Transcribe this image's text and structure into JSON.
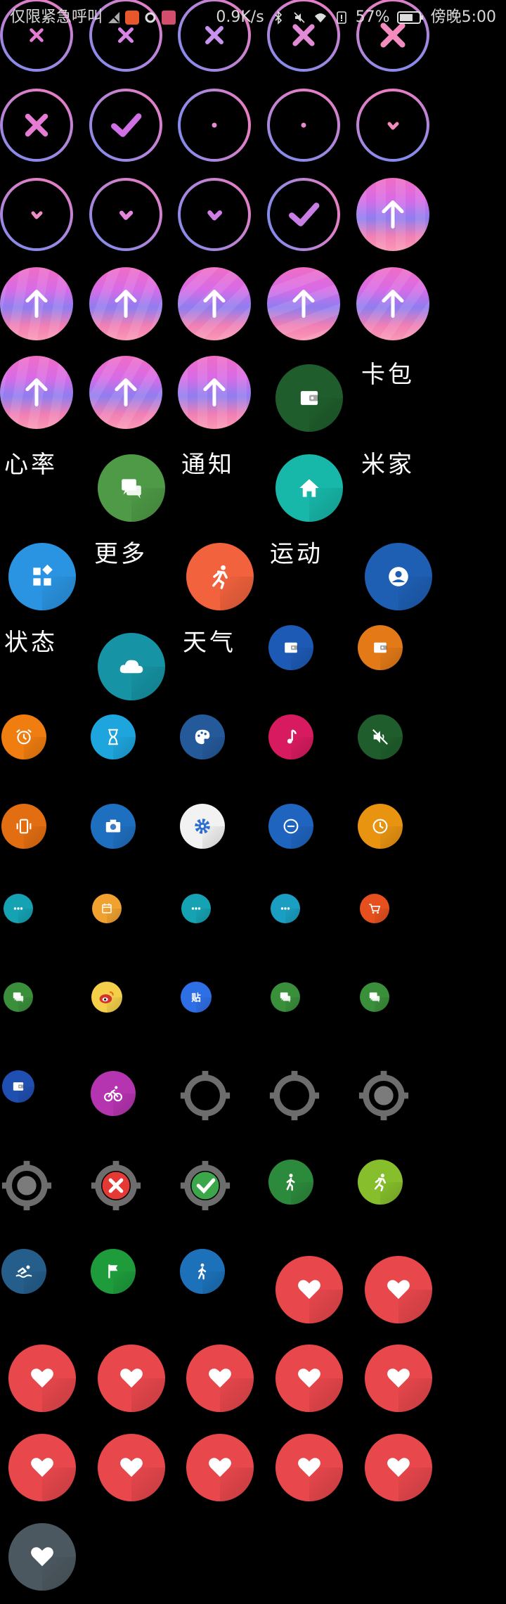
{
  "status_bar": {
    "carrier": "仅限紧急呼叫",
    "speed": "0.9K/s",
    "battery": "57%",
    "time": "傍晚5:00"
  },
  "labels": {
    "card": "卡包",
    "heart": "心率",
    "notify": "通知",
    "home": "米家",
    "more": "更多",
    "sport": "运动",
    "state": "状态",
    "weather": "天气"
  },
  "colors": {
    "ring_pink": "#f27dc0",
    "ring_blue": "#7b8cf0",
    "wallet_green": "#1f5e2c",
    "home_teal": "#17b7a9",
    "chat_green": "#4e9a46",
    "grid_blue": "#2a94e2",
    "sport_orange": "#f1623d",
    "profile_blue": "#1e5fb4",
    "cloud_teal": "#1693a4",
    "heart_red": "#e8474c",
    "heart_gray": "#4c5860"
  },
  "icons": [
    "close-icon",
    "check-icon",
    "dot-icon",
    "arrow-up-icon",
    "wallet-icon",
    "chat-icon",
    "home-icon",
    "grid-icon",
    "run-icon",
    "profile-icon",
    "cloud-icon",
    "alarm-icon",
    "hourglass-icon",
    "palette-icon",
    "music-icon",
    "mute-icon",
    "vibrate-icon",
    "camera-icon",
    "gear-icon",
    "minus-icon",
    "clock-icon",
    "more-icon",
    "calendar-icon",
    "cart-icon",
    "weibo-icon",
    "tieba-icon",
    "bike-icon",
    "target-icon",
    "walk-icon",
    "swim-icon",
    "flag-icon",
    "heart-icon"
  ]
}
